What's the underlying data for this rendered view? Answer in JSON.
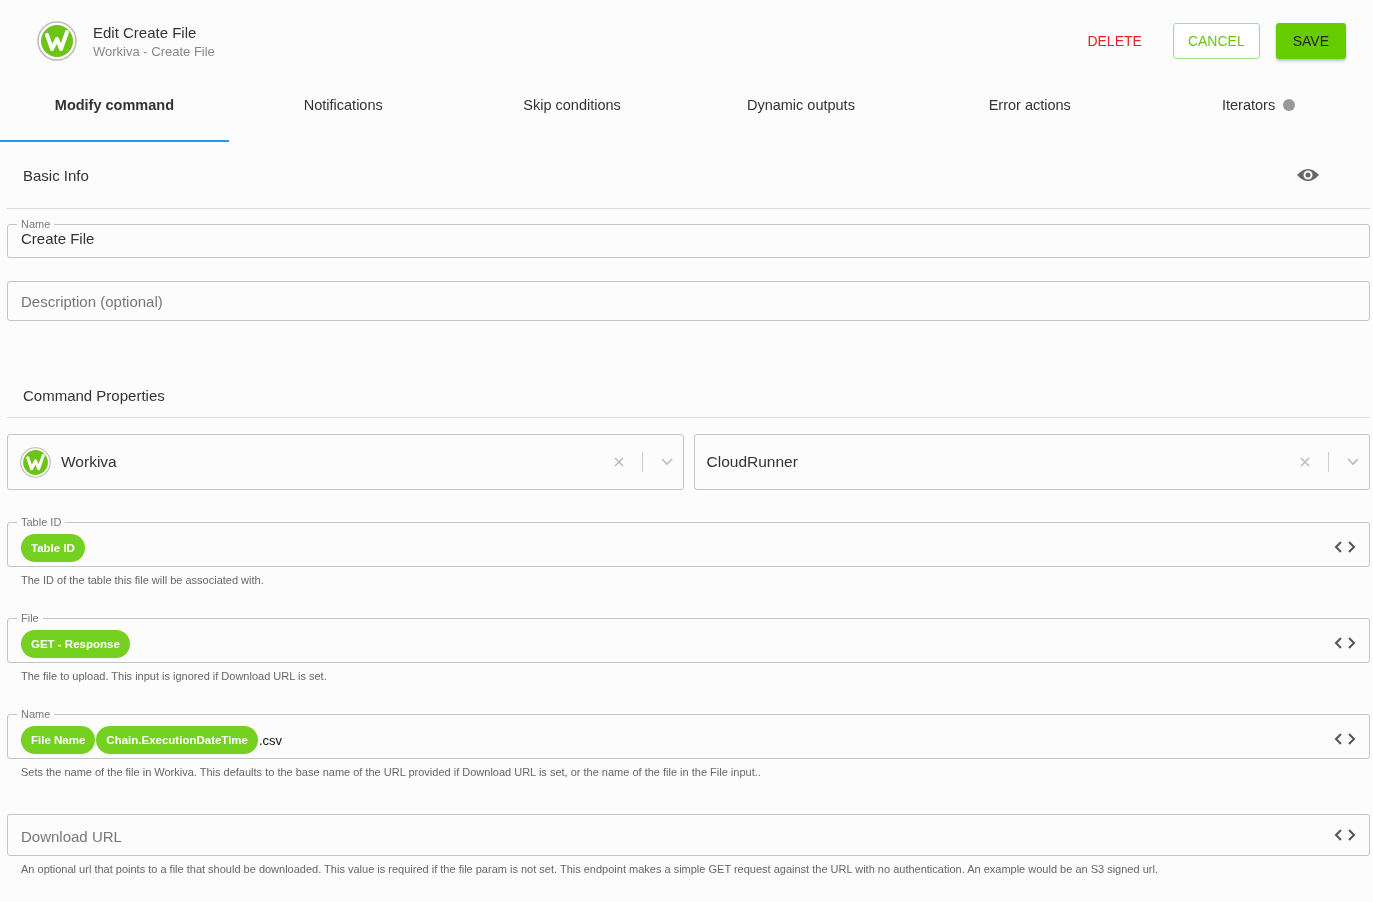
{
  "header": {
    "title": "Edit Create File",
    "subtitle": "Workiva - Create File",
    "actions": [
      {
        "label": "DELETE",
        "kind": "danger"
      },
      {
        "label": "CANCEL",
        "kind": "outline"
      },
      {
        "label": "SAVE",
        "kind": "primary"
      }
    ]
  },
  "tabs": [
    {
      "label": "Modify command",
      "selected": true
    },
    {
      "label": "Notifications",
      "selected": false
    },
    {
      "label": "Skip conditions",
      "selected": false
    },
    {
      "label": "Dynamic outputs",
      "selected": false
    },
    {
      "label": "Error actions",
      "selected": false
    },
    {
      "label": "Iterators",
      "selected": false,
      "dot": true
    }
  ],
  "basic_info": {
    "title": "Basic Info",
    "name_field": {
      "label": "Name",
      "value": "Create File"
    },
    "description_field": {
      "placeholder": "Description (optional)"
    }
  },
  "command_properties": {
    "title": "Command Properties",
    "selects": [
      {
        "value": "Workiva",
        "logo": true
      },
      {
        "value": "CloudRunner",
        "logo": false
      }
    ],
    "inputs": [
      {
        "label": "Table ID",
        "segments": [
          {
            "kind": "token",
            "text": "Table ID"
          }
        ],
        "help": "The ID of the table this file will be associated with."
      },
      {
        "label": "File",
        "segments": [
          {
            "kind": "token",
            "text": "GET - Response"
          }
        ],
        "help": "The file to upload. This input is ignored if Download URL is set."
      },
      {
        "label": "Name",
        "segments": [
          {
            "kind": "token",
            "text": "File Name"
          },
          {
            "kind": "token",
            "text": "Chain.ExecutionDateTime"
          },
          {
            "kind": "text",
            "text": ".csv"
          }
        ],
        "help": "Sets the name of the file in Workiva. This defaults to the base name of the URL provided if Download URL is set, or the name of the file in the File input.."
      },
      {
        "placeholder": "Download URL",
        "help": "An optional url that points to a file that should be downloaded. This value is required if the file param is not set. This endpoint makes a simple GET request against the URL with no authentication. An example would be an S3 signed url."
      }
    ]
  }
}
